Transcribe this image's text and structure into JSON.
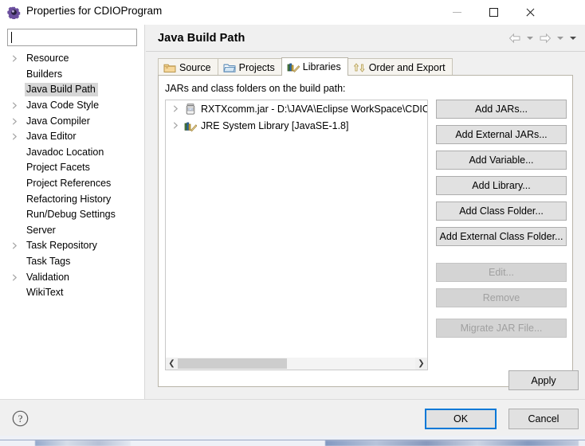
{
  "window": {
    "title": "Properties for CDIOProgram",
    "icon": "properties-gear-icon",
    "controls": {
      "minimize": "minimize-icon",
      "maximize": "maximize-icon",
      "close": "close-icon"
    }
  },
  "sidebar": {
    "filter": {
      "value": "",
      "placeholder": ""
    },
    "items": [
      {
        "label": "Resource",
        "expandable": true,
        "selected": false
      },
      {
        "label": "Builders",
        "expandable": false,
        "selected": false
      },
      {
        "label": "Java Build Path",
        "expandable": false,
        "selected": true
      },
      {
        "label": "Java Code Style",
        "expandable": true,
        "selected": false
      },
      {
        "label": "Java Compiler",
        "expandable": true,
        "selected": false
      },
      {
        "label": "Java Editor",
        "expandable": true,
        "selected": false
      },
      {
        "label": "Javadoc Location",
        "expandable": false,
        "selected": false
      },
      {
        "label": "Project Facets",
        "expandable": false,
        "selected": false
      },
      {
        "label": "Project References",
        "expandable": false,
        "selected": false
      },
      {
        "label": "Refactoring History",
        "expandable": false,
        "selected": false
      },
      {
        "label": "Run/Debug Settings",
        "expandable": false,
        "selected": false
      },
      {
        "label": "Server",
        "expandable": false,
        "selected": false
      },
      {
        "label": "Task Repository",
        "expandable": true,
        "selected": false
      },
      {
        "label": "Task Tags",
        "expandable": false,
        "selected": false
      },
      {
        "label": "Validation",
        "expandable": true,
        "selected": false
      },
      {
        "label": "WikiText",
        "expandable": false,
        "selected": false
      }
    ]
  },
  "content": {
    "page_title": "Java Build Path",
    "nav": {
      "back": "back-arrow-icon",
      "back_menu": "chevron-down-icon",
      "forward": "forward-arrow-icon",
      "forward_menu": "chevron-down-icon",
      "view_menu": "chevron-down-icon"
    },
    "tabs": [
      {
        "label": "Source",
        "icon": "source-folder-icon",
        "active": false
      },
      {
        "label": "Projects",
        "icon": "projects-folder-icon",
        "active": false
      },
      {
        "label": "Libraries",
        "icon": "libraries-books-icon",
        "active": true
      },
      {
        "label": "Order and Export",
        "icon": "order-arrows-icon",
        "active": false
      }
    ],
    "panel": {
      "label": "JARs and class folders on the build path:",
      "entries": [
        {
          "text": "RXTXcomm.jar - D:\\JAVA\\Eclipse WorkSpace\\CDIO",
          "icon": "jar-icon",
          "expandable": true
        },
        {
          "text": "JRE System Library [JavaSE-1.8]",
          "icon": "library-icon",
          "expandable": true
        }
      ],
      "scrollbar": {
        "left_arrow": "scroll-left-icon",
        "right_arrow": "scroll-right-icon"
      },
      "buttons": [
        {
          "label": "Add JARs...",
          "enabled": true
        },
        {
          "label": "Add External JARs...",
          "enabled": true
        },
        {
          "label": "Add Variable...",
          "enabled": true
        },
        {
          "label": "Add Library...",
          "enabled": true
        },
        {
          "label": "Add Class Folder...",
          "enabled": true
        },
        {
          "label": "Add External Class Folder...",
          "enabled": true
        },
        {
          "label": "Edit...",
          "enabled": false
        },
        {
          "label": "Remove",
          "enabled": false
        },
        {
          "label": "Migrate JAR File...",
          "enabled": false
        }
      ]
    },
    "apply_label": "Apply"
  },
  "footer": {
    "help": "help-icon",
    "ok_label": "OK",
    "cancel_label": "Cancel"
  },
  "colors": {
    "focus_blue": "#0078d7",
    "selection_gray": "#d6d6d6",
    "button_face": "#e1e1e1",
    "dialog_bg": "#f0f0f0"
  }
}
